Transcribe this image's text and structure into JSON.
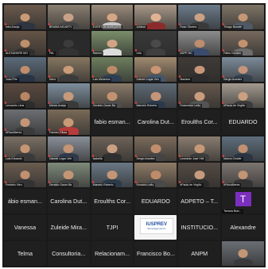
{
  "tiles": [
    {
      "type": "video",
      "label": "Inês Araújo",
      "bg": "#6b5a4c",
      "skin": "#c99a78",
      "shirt": "#2e3440",
      "mic": true
    },
    {
      "type": "video",
      "label": "BRAWA NICARTY",
      "bg": "#8a7f71",
      "skin": "#c9a088",
      "shirt": "#444444",
      "mic": true
    },
    {
      "type": "video",
      "label": "EVERTON MARQUES",
      "bg": "#9b8b7b",
      "skin": "#d4a684",
      "shirt": "#c8c8c8",
      "mic": true
    },
    {
      "type": "video",
      "label": "Juliana",
      "bg": "#a89888",
      "skin": "#e0b294",
      "shirt": "#8b2b2b",
      "mic": true
    },
    {
      "type": "video",
      "label": "Rose Oliveira",
      "bg": "#6c7b8a",
      "skin": "#caa283",
      "shirt": "#3a3a3a",
      "mic": true
    },
    {
      "type": "video",
      "label": "Thiago Bonafé",
      "bg": "#7e7466",
      "skin": "#c59777",
      "shirt": "#505a66",
      "mic": true
    },
    {
      "type": "video",
      "label": "ALEXANDRE MO",
      "bg": "#655447",
      "skin": "#bf8f6c",
      "shirt": "#2f2f2f",
      "mic": true
    },
    {
      "type": "video",
      "label": "PAL",
      "bg": "#2a2a2a",
      "skin": "#3b3b3b",
      "shirt": "#333333",
      "mic": true
    },
    {
      "type": "video",
      "label": "Ramon",
      "bg": "#7a8d6a",
      "skin": "#d0a485",
      "shirt": "#dddddd",
      "mic": true
    },
    {
      "type": "video",
      "label": "Lilia",
      "bg": "#3a3a3a",
      "skin": "#4a4a4a",
      "shirt": "#3f3f3f",
      "mic": true
    },
    {
      "type": "video",
      "label": "ADPF-NC",
      "bg": "#8c8c8c",
      "skin": "#bd8e6d",
      "shirt": "#3b4b6b",
      "mic": true
    },
    {
      "type": "video",
      "label": "Fábio Cezário",
      "bg": "#76695d",
      "skin": "#c2936f",
      "shirt": "#6d6d6d",
      "mic": true
    },
    {
      "type": "video",
      "label": "Juan Pris",
      "bg": "#5b6b7a",
      "skin": "#c08e6a",
      "shirt": "#293445",
      "mic": true
    },
    {
      "type": "video",
      "label": "Heno",
      "bg": "#867660",
      "skin": "#ca9c7a",
      "shirt": "#3b3b3b",
      "mic": true
    },
    {
      "type": "video",
      "label": "Luis Medeiros",
      "bg": "#6e7e5e",
      "skin": "#bb8b68",
      "shirt": "#2f3e52",
      "mic": true
    },
    {
      "type": "video",
      "label": "Gabriel Lúgar Veh",
      "bg": "#a08a70",
      "skin": "#c99574",
      "shirt": "#44556b",
      "mic": true
    },
    {
      "type": "video",
      "label": "Mariana",
      "bg": "#3f3a36",
      "skin": "#c8977a",
      "shirt": "#2c2c2c",
      "mic": true
    },
    {
      "type": "video",
      "label": "Sérgio Arantes",
      "bg": "#7c8b99",
      "skin": "#c4957a",
      "shirt": "#35404d",
      "mic": true
    },
    {
      "type": "video",
      "label": "Leonardo Lima",
      "bg": "#5a4a3f",
      "skin": "#b88665",
      "shirt": "#2c2c2c",
      "mic": true
    },
    {
      "type": "video",
      "label": "Márcio Araújo",
      "bg": "#7d8e9c",
      "skin": "#c79a7c",
      "shirt": "#3a3a3a",
      "mic": true
    },
    {
      "type": "video",
      "label": "Geraldo Gauer Ba",
      "bg": "#8a7a68",
      "skin": "#c29272",
      "shirt": "#4d4d4d",
      "mic": true
    },
    {
      "type": "video",
      "label": "Marcelo Roberto",
      "bg": "#5e6a74",
      "skin": "#c4957a",
      "shirt": "#2a3a4a",
      "mic": true
    },
    {
      "type": "video",
      "label": "Rosemeire Leão",
      "bg": "#66584c",
      "skin": "#ca9c7e",
      "shirt": "#545454",
      "mic": true
    },
    {
      "type": "video",
      "label": "#Paula de Virgilio",
      "bg": "#a39a8e",
      "skin": "#caa080",
      "shirt": "#3a3a3a",
      "mic": true
    },
    {
      "type": "video",
      "label": "#PsicoMeres",
      "bg": "#6c6f73",
      "skin": "#c49677",
      "shirt": "#3a3a3a",
      "mic": true
    },
    {
      "type": "video",
      "label": "Fabricio Ribas",
      "bg": "#7a6a58",
      "skin": "#c89a78",
      "shirt": "#b63b3b",
      "mic": true
    },
    {
      "type": "nameonly",
      "label": "fabio esman..."
    },
    {
      "type": "nameonly",
      "label": "Carolina Dut..."
    },
    {
      "type": "nameonly",
      "label": "Eroulths Cor..."
    },
    {
      "type": "nameonly",
      "label": "EDUARDO"
    },
    {
      "type": "video",
      "label": "Luis Eduardo",
      "bg": "#7a6f63",
      "skin": "#c49674",
      "shirt": "#3a3a3a",
      "mic": true
    },
    {
      "type": "video",
      "label": "Gabriel Lúgar Veh",
      "bg": "#8a9098",
      "skin": "#c39475",
      "shirt": "#30394a",
      "mic": true
    },
    {
      "type": "video",
      "label": "Isabella",
      "bg": "#6e6358",
      "skin": "#caa083",
      "shirt": "#2f2f2f",
      "mic": true
    },
    {
      "type": "video",
      "label": "Sergio Arantes",
      "bg": "#7b6b5b",
      "skin": "#bf8e6e",
      "shirt": "#444444",
      "mic": true
    },
    {
      "type": "video",
      "label": "Leonardo José Yéli",
      "bg": "#8a7d70",
      "skin": "#c79877",
      "shirt": "#3c3c3c",
      "mic": true
    },
    {
      "type": "video",
      "label": "Marcio Challer",
      "bg": "#5f6e7c",
      "skin": "#c0906f",
      "shirt": "#2b3440",
      "mic": true
    },
    {
      "type": "video",
      "label": "Frederic Vieu",
      "bg": "#6a5c50",
      "skin": "#c09070",
      "shirt": "#333333",
      "mic": true
    },
    {
      "type": "video",
      "label": "Geraldo Gauer Ba",
      "bg": "#7f8a7a",
      "skin": "#c49575",
      "shirt": "#3f3f3f",
      "mic": true
    },
    {
      "type": "video",
      "label": "Marcelo Roberto",
      "bg": "#6a7885",
      "skin": "#c39677",
      "shirt": "#2c3a48",
      "mic": true
    },
    {
      "type": "video",
      "label": "Ronaldo Leão",
      "bg": "#8e7b66",
      "skin": "#bc8c6b",
      "shirt": "#4a4a4a",
      "mic": true
    },
    {
      "type": "video",
      "label": "#Paula de Virgilio",
      "bg": "#554b44",
      "skin": "#c69b7e",
      "shirt": "#2a2a2a",
      "mic": true
    },
    {
      "type": "video",
      "label": "#PsicoMeres",
      "bg": "#7d7570",
      "skin": "#c29575",
      "shirt": "#333333",
      "mic": true
    },
    {
      "type": "nameonly",
      "label": "ábio esman..."
    },
    {
      "type": "nameonly",
      "label": "Carolina Dut..."
    },
    {
      "type": "nameonly",
      "label": "Eroulths Cor..."
    },
    {
      "type": "nameonly",
      "label": "EDUARDO"
    },
    {
      "type": "nameonly",
      "label": "ADPETO – T..."
    },
    {
      "type": "purple",
      "label": "Tamara Brav...",
      "letter": "T"
    },
    {
      "type": "nameonly",
      "label": "Vanessa"
    },
    {
      "type": "nameonly",
      "label": "Zuleide Mira..."
    },
    {
      "type": "nameonly",
      "label": "TJPI"
    },
    {
      "type": "logo",
      "label": "",
      "logo_text": "IUSPREV",
      "logo_sub": "Tecnologia da Inf."
    },
    {
      "type": "nameonly",
      "label": "INSTITUCIO..."
    },
    {
      "type": "nameonly",
      "label": "Alexandre"
    },
    {
      "type": "nameonly",
      "label": "Telma"
    },
    {
      "type": "nameonly",
      "label": "Consultoria..."
    },
    {
      "type": "nameonly",
      "label": "Relacionam..."
    },
    {
      "type": "nameonly",
      "label": "Francisco Bo..."
    },
    {
      "type": "nameonly",
      "label": "ANPM"
    },
    {
      "type": "video",
      "label": "",
      "bg": "#6a6f74",
      "skin": "#c49676",
      "shirt": "#3a3a3a",
      "mic": false
    }
  ]
}
